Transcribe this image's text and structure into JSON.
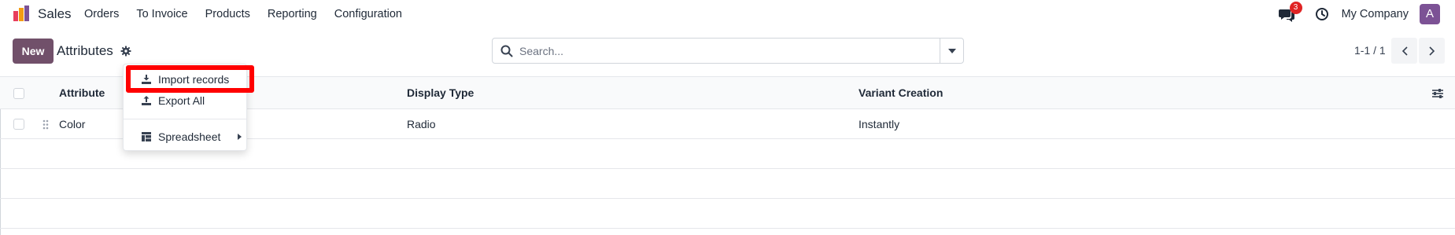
{
  "navbar": {
    "app_name": "Sales",
    "menu": [
      "Orders",
      "To Invoice",
      "Products",
      "Reporting",
      "Configuration"
    ],
    "chat_badge_count": "3",
    "company": "My Company",
    "avatar_letter": "A",
    "logo_colors": [
      "#e83e5c",
      "#f39c12",
      "#7c5295"
    ],
    "avatar_color": "#7c5295"
  },
  "control_panel": {
    "new_label": "New",
    "title": "Attributes",
    "search_placeholder": "Search...",
    "pager": "1-1 / 1",
    "accent_color": "#71506a"
  },
  "list": {
    "columns": [
      "Attribute",
      "Display Type",
      "Variant Creation"
    ],
    "rows": [
      {
        "attribute": "Color",
        "display_type": "Radio",
        "variant_creation": "Instantly"
      }
    ]
  },
  "dropdown": {
    "items": [
      {
        "label": "Import records",
        "icon": "download-icon"
      },
      {
        "label": "Export All",
        "icon": "upload-icon"
      },
      {
        "label": "Spreadsheet",
        "icon": "spreadsheet-icon"
      }
    ],
    "highlight_color": "#ff0000"
  }
}
